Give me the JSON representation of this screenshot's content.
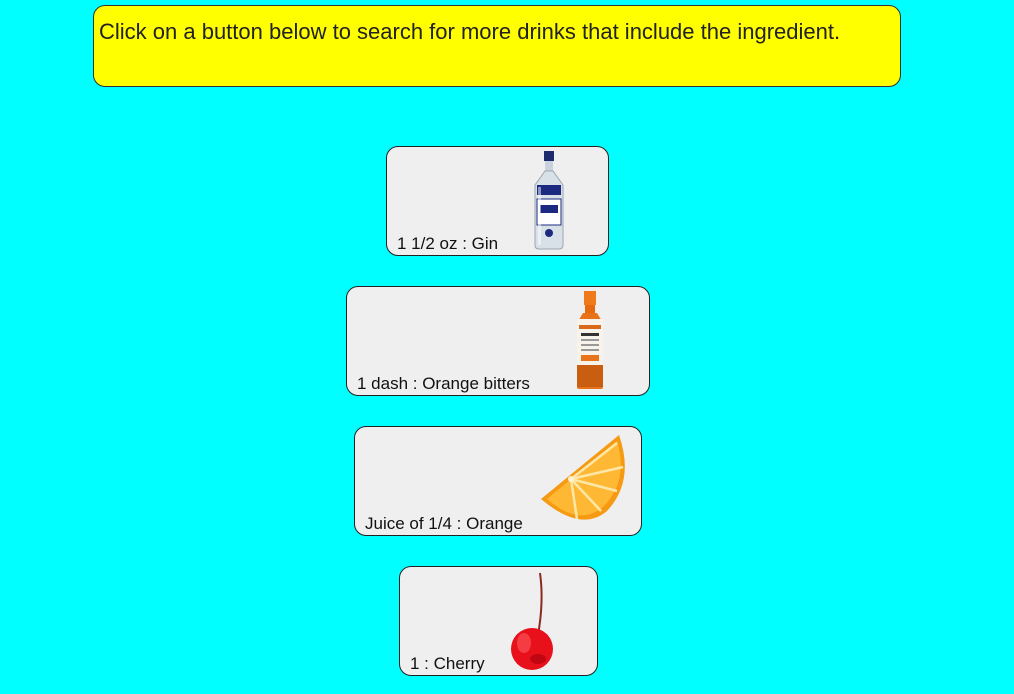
{
  "instruction": "Click on a button below to search for more drinks that include the ingredient.",
  "ingredients": [
    {
      "label": "1 1/2 oz : Gin",
      "icon": "gin-bottle-icon"
    },
    {
      "label": "1 dash : Orange bitters",
      "icon": "orange-bitters-bottle-icon"
    },
    {
      "label": "Juice of 1/4 : Orange",
      "icon": "orange-slice-icon"
    },
    {
      "label": "1 : Cherry",
      "icon": "cherry-icon"
    }
  ],
  "colors": {
    "background": "#00ffff",
    "banner": "#ffff00",
    "button": "#efefef"
  }
}
